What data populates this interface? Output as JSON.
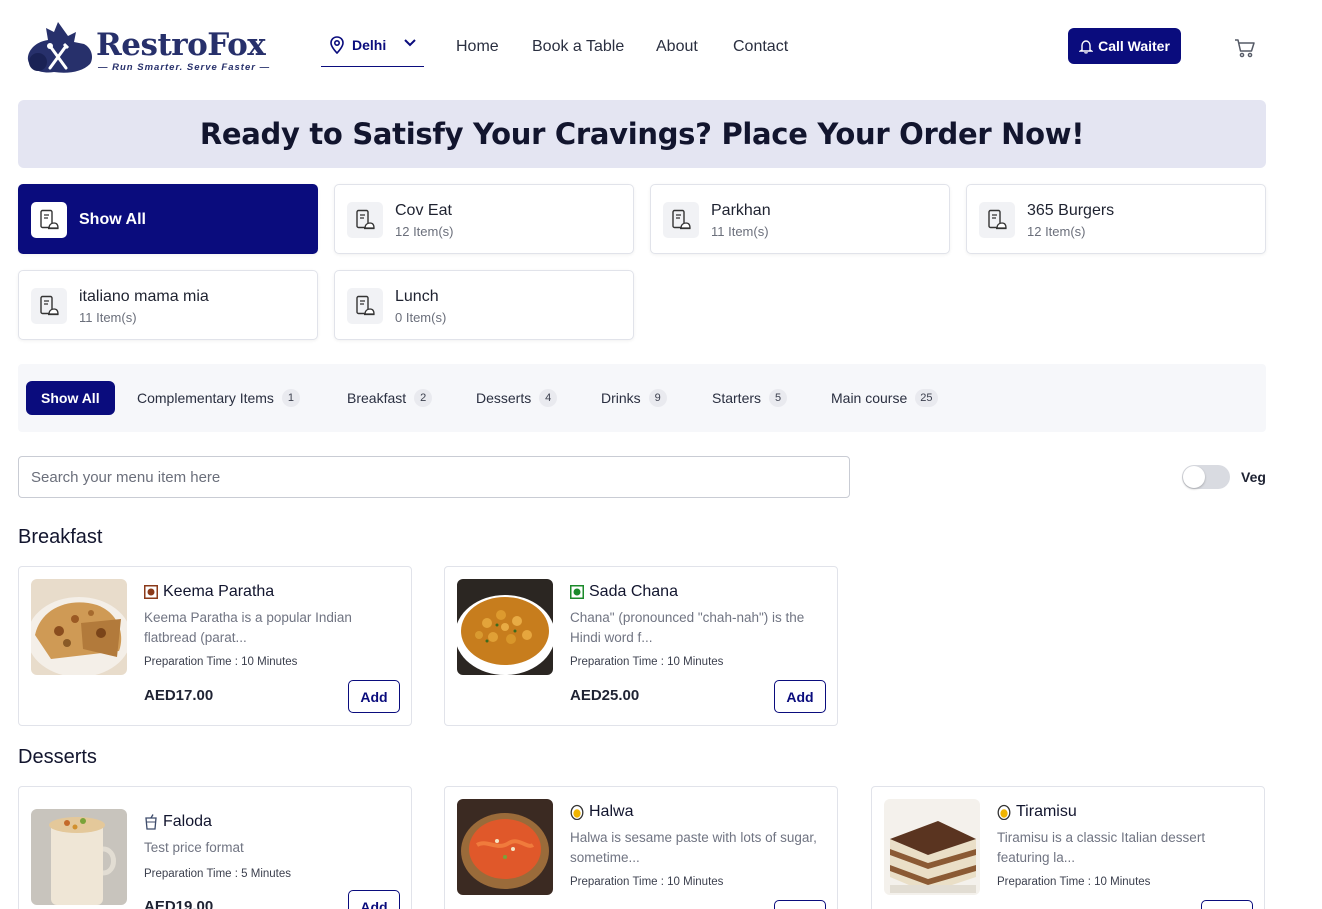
{
  "header": {
    "logo_text": "RestroFox",
    "logo_tagline": "Run Smarter. Serve Faster",
    "location": "Delhi",
    "nav": [
      "Home",
      "Book a Table",
      "About",
      "Contact"
    ],
    "call_waiter": "Call Waiter",
    "icons": {
      "location": "location-pin-icon",
      "dropdown": "chevron-down-icon",
      "bell": "bell-icon",
      "cart": "cart-icon"
    }
  },
  "banner": {
    "text": "Ready to Satisfy Your Cravings? Place Your Order Now!"
  },
  "restaurants": [
    {
      "name": "Show All",
      "count": "",
      "active": true
    },
    {
      "name": "Cov Eat",
      "count": "12 Item(s)"
    },
    {
      "name": "Parkhan",
      "count": "11 Item(s)"
    },
    {
      "name": "365 Burgers",
      "count": "12 Item(s)"
    },
    {
      "name": "italiano mama mia",
      "count": "11 Item(s)"
    },
    {
      "name": "Lunch",
      "count": "0 Item(s)"
    }
  ],
  "categories": [
    {
      "label": "Show All",
      "count": "",
      "active": true
    },
    {
      "label": "Complementary Items",
      "count": "1"
    },
    {
      "label": "Breakfast",
      "count": "2"
    },
    {
      "label": "Desserts",
      "count": "4"
    },
    {
      "label": "Drinks",
      "count": "9"
    },
    {
      "label": "Starters",
      "count": "5"
    },
    {
      "label": "Main course",
      "count": "25"
    }
  ],
  "search": {
    "placeholder": "Search your menu item here"
  },
  "veg_toggle": {
    "label": "Veg",
    "on": false
  },
  "sections": [
    {
      "title": "Breakfast",
      "items": [
        {
          "name": "Keema Paratha",
          "tag": "non-veg",
          "description": "Keema Paratha is a popular Indian flatbread (parat...",
          "prep": "Preparation Time : 10 Minutes",
          "price": "AED17.00",
          "add": "Add"
        },
        {
          "name": "Sada Chana",
          "tag": "veg",
          "description": "Chana\" (pronounced \"chah-nah\") is the Hindi word f...",
          "prep": "Preparation Time : 10 Minutes",
          "price": "AED25.00",
          "add": "Add"
        }
      ]
    },
    {
      "title": "Desserts",
      "items": [
        {
          "name": "Faloda",
          "tag": "drink",
          "description": "Test price format",
          "prep": "Preparation Time : 5 Minutes",
          "price": "AED19.00",
          "add": "Add"
        },
        {
          "name": "Halwa",
          "tag": "egg",
          "description": "Halwa is sesame paste with lots of sugar, sometime...",
          "prep": "Preparation Time : 10 Minutes",
          "price": "",
          "add": "Add"
        },
        {
          "name": "Tiramisu",
          "tag": "egg",
          "description": "Tiramisu is a classic Italian dessert featuring la...",
          "prep": "Preparation Time : 10 Minutes",
          "price": "",
          "add": "Add"
        }
      ]
    }
  ],
  "colors": {
    "primary": "#0a0c7d",
    "banner_bg": "#e4e5f2",
    "veg": "#1b8a2a",
    "non_veg": "#8b3a1a",
    "egg": "#f0b400"
  }
}
